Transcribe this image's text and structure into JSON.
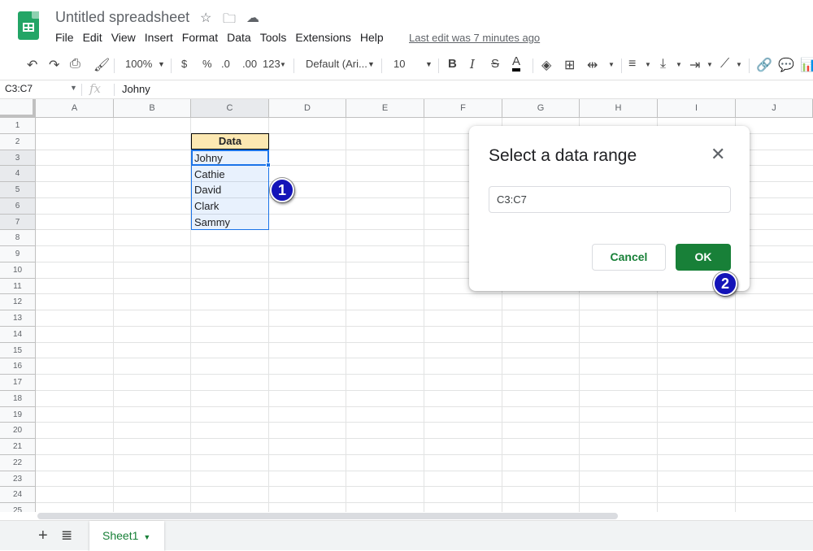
{
  "app": {
    "title": "Untitled spreadsheet",
    "menu": [
      "File",
      "Edit",
      "View",
      "Insert",
      "Format",
      "Data",
      "Tools",
      "Extensions",
      "Help"
    ],
    "last_edit": "Last edit was 7 minutes ago"
  },
  "toolbar": {
    "zoom": "100%",
    "currency": "$",
    "percent": "%",
    "decrease_decimal": ".0",
    "increase_decimal": ".00",
    "more_formats": "123",
    "font": "Default (Ari...",
    "font_size": "10",
    "bold": "B",
    "italic": "I",
    "strike": "S",
    "text_color": "A"
  },
  "formula_bar": {
    "name_box": "C3:C7",
    "fx": "fx",
    "value": "Johny"
  },
  "grid": {
    "columns": [
      "A",
      "B",
      "C",
      "D",
      "E",
      "F",
      "G",
      "H",
      "I",
      "J"
    ],
    "rows": [
      "1",
      "2",
      "3",
      "4",
      "5",
      "6",
      "7",
      "8",
      "9",
      "10",
      "11",
      "12",
      "13",
      "14",
      "15",
      "16",
      "17",
      "18",
      "19",
      "20",
      "21",
      "22",
      "23",
      "24",
      "25"
    ],
    "header_cell": "Data",
    "values": [
      "Johny",
      "Cathie",
      "David",
      "Clark",
      "Sammy"
    ]
  },
  "callouts": [
    "1",
    "2"
  ],
  "dialog": {
    "title": "Select a data range",
    "range_value": "C3:C7",
    "cancel": "Cancel",
    "ok": "OK"
  },
  "sheets": {
    "active": "Sheet1"
  },
  "colors": {
    "accent_green": "#188038",
    "selection_blue": "#1a73e8",
    "header_fill": "#fce8b2"
  }
}
